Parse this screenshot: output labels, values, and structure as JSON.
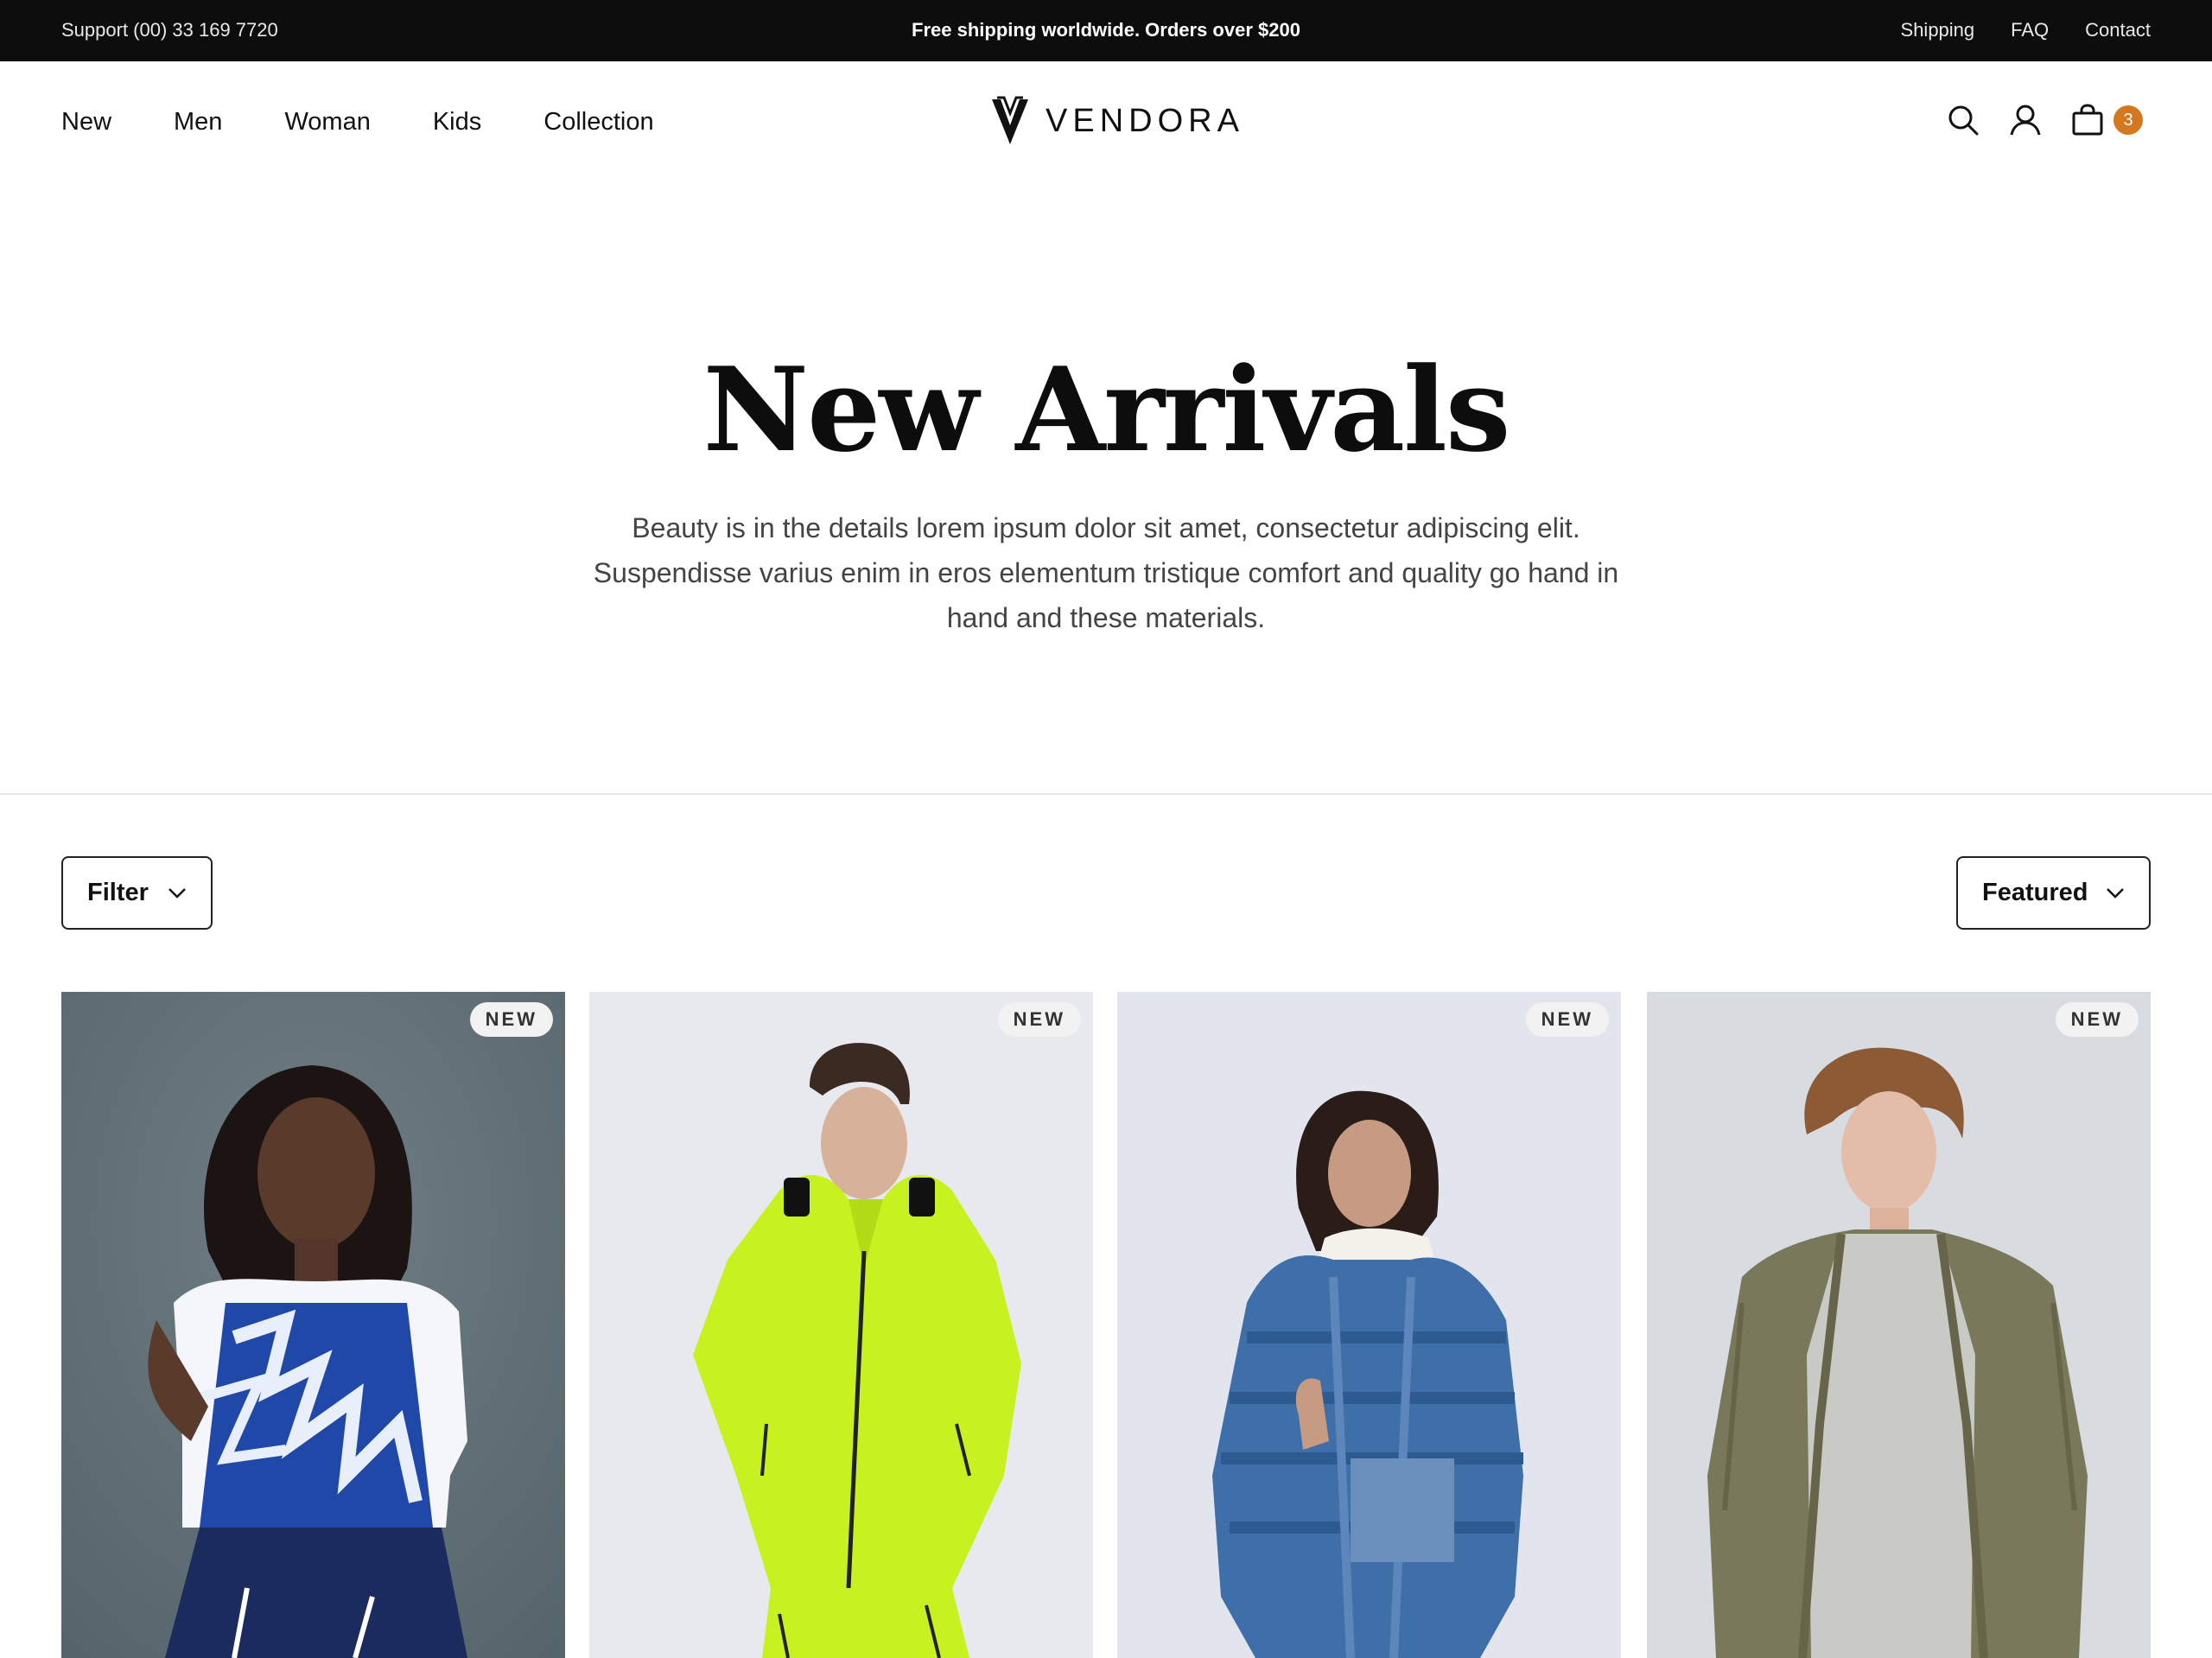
{
  "topbar": {
    "support": "Support (00) 33 169 7720",
    "promo": "Free shipping worldwide. Orders over $200",
    "links": [
      "Shipping",
      "FAQ",
      "Contact"
    ]
  },
  "nav": {
    "items": [
      "New",
      "Men",
      "Woman",
      "Kids",
      "Collection"
    ]
  },
  "brand": {
    "name": "VENDORA"
  },
  "actions": {
    "icons": [
      "search-icon",
      "user-icon",
      "bag-icon"
    ],
    "cart_count": "3",
    "badge_color": "#d4771f"
  },
  "hero": {
    "title": "New Arrivals",
    "subtitle": "Beauty is in the details lorem ipsum dolor sit amet, consectetur adipiscing elit. Suspendisse varius enim in eros elementum tristique comfort and quality go hand in hand and these materials."
  },
  "controls": {
    "filter_label": "Filter",
    "sort_label": "Featured"
  },
  "products": [
    {
      "tag": "NEW"
    },
    {
      "tag": "NEW"
    },
    {
      "tag": "NEW"
    },
    {
      "tag": "NEW"
    }
  ]
}
